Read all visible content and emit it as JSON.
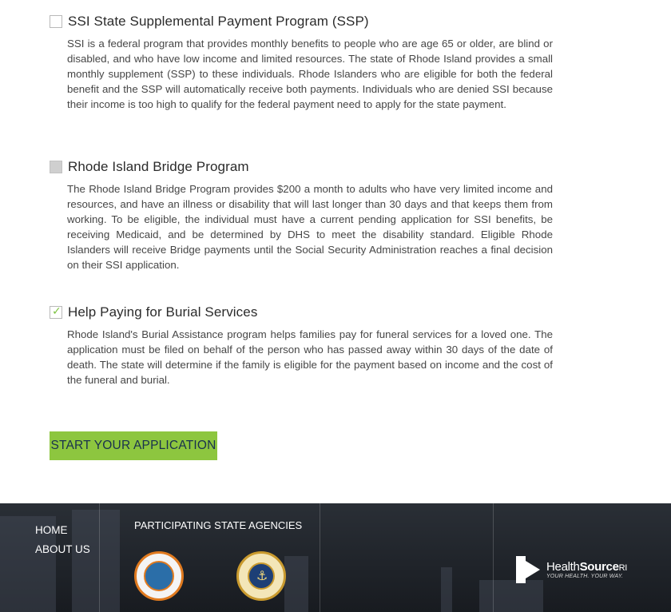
{
  "programs": [
    {
      "title": "SSI State Supplemental Payment Program (SSP)",
      "state": "unchecked",
      "description": "SSI is a federal program that provides monthly benefits to people who are age 65 or older, are blind or disabled, and who have low income and limited resources. The state of Rhode Island provides a small monthly supplement (SSP) to these individuals. Rhode Islanders who are eligible for both the federal benefit and the SSP will automatically receive both payments. Individuals who are denied SSI because their income is too high to qualify for the federal payment need to apply for the state payment."
    },
    {
      "title": "Rhode Island Bridge Program",
      "state": "disabled",
      "description": "The Rhode Island Bridge Program provides $200 a month to adults who have very limited income and resources, and have an illness or disability that will last longer than 30 days and that keeps them from working. To be eligible, the individual must have a current pending application for SSI benefits, be receiving Medicaid, and be determined by DHS to meet the disability standard. Eligible Rhode Islanders will receive Bridge payments until the Social Security Administration reaches a final decision on their SSI application."
    },
    {
      "title": "Help Paying for Burial Services",
      "state": "checked",
      "check_glyph": "✓",
      "description": "Rhode Island's Burial Assistance program helps families pay for funeral services for a loved one. The application must be filed on behalf of the person who has passed away within 30 days of the date of death. The state will determine if the family is eligible for the payment based on income and the cost of the funeral and burial."
    }
  ],
  "start_button": {
    "label": "START YOUR APPLICATION"
  },
  "footer": {
    "links": [
      "HOME",
      "ABOUT US"
    ],
    "agencies_title": "PARTICIPATING STATE AGENCIES",
    "seals": [
      "rhode-island-department-of-human-services-seal",
      "executive-office-of-health-and-human-services-seal"
    ],
    "logo": {
      "name_light": "Health",
      "name_bold": "Source",
      "name_suffix": "RI",
      "tagline": "YOUR HEALTH. YOUR WAY."
    }
  },
  "colors": {
    "accent_green": "#8dc63f",
    "button_text": "#19314e",
    "footer_bg": "#1f2329"
  }
}
